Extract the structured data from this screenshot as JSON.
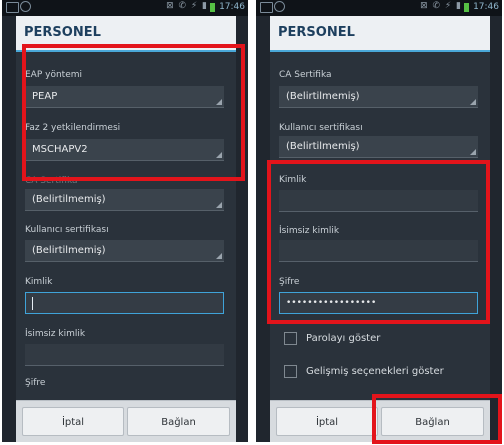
{
  "status_time": "17:46",
  "status_icons": "⊠ ✆ ⚡ ▮",
  "left": {
    "title": "PERSONEL",
    "eap_method_label": "EAP yöntemi",
    "eap_method_value": "PEAP",
    "phase2_label": "Faz 2 yetkilendirmesi",
    "phase2_value": "MSCHAPV2",
    "ca_cert_label": "CA Sertifika",
    "ca_cert_value": "(Belirtilmemiş)",
    "user_cert_label": "Kullanıcı sertifikası",
    "user_cert_value": "(Belirtilmemiş)",
    "identity_label": "Kimlik",
    "identity_value": "",
    "anon_identity_label": "İsimsiz kimlik",
    "anon_identity_value": "",
    "password_label": "Şifre",
    "cancel_label": "İptal",
    "connect_label": "Bağlan"
  },
  "right": {
    "title": "PERSONEL",
    "ca_cert_label": "CA Sertifika",
    "ca_cert_value": "(Belirtilmemiş)",
    "user_cert_label": "Kullanıcı sertifikası",
    "user_cert_value": "(Belirtilmemiş)",
    "identity_label": "Kimlik",
    "identity_value": "",
    "anon_identity_label": "İsimsiz kimlik",
    "anon_identity_value": "",
    "password_label": "Şifre",
    "password_value": "•••••••••••••••••",
    "show_password_label": "Parolayı göster",
    "show_advanced_label": "Gelişmiş seçenekleri göster",
    "cancel_label": "İptal",
    "connect_label": "Bağlan"
  },
  "colors": {
    "highlight": "#e3141b",
    "accent": "#4aa8d8",
    "title_text": "#1d3f5e"
  }
}
